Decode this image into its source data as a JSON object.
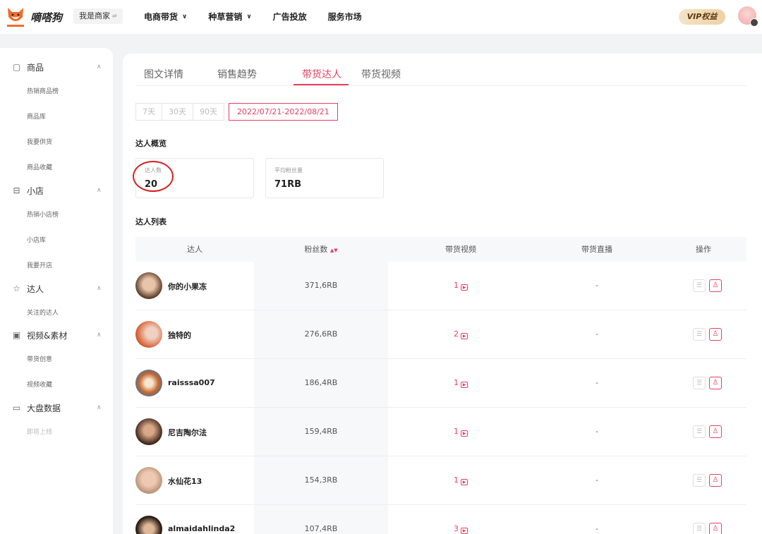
{
  "header": {
    "brand": "嘀嗒狗",
    "role_switch": "我是商家",
    "nav": [
      {
        "label": "电商带货",
        "has_dropdown": true
      },
      {
        "label": "种草营销",
        "has_dropdown": true
      },
      {
        "label": "广告投放",
        "has_dropdown": false
      },
      {
        "label": "服务市场",
        "has_dropdown": false
      }
    ],
    "vip_label": "VIP权益"
  },
  "sidebar": {
    "groups": [
      {
        "label": "商品",
        "icon": "bag-icon",
        "items": [
          "热销商品榜",
          "商品库",
          "我要供货",
          "商品收藏"
        ]
      },
      {
        "label": "小店",
        "icon": "store-icon",
        "items": [
          "热销小店榜",
          "小店库",
          "我要开店"
        ]
      },
      {
        "label": "达人",
        "icon": "star-icon",
        "items": [
          "关注的达人"
        ]
      },
      {
        "label": "视频&素材",
        "icon": "video-icon",
        "items": [
          "带货创意",
          "视频收藏"
        ]
      },
      {
        "label": "大盘数据",
        "icon": "monitor-icon",
        "items": [
          "即将上线"
        ]
      }
    ]
  },
  "tabs": [
    "图文详情",
    "销售趋势",
    "带货达人",
    "带货视频"
  ],
  "active_tab": "带货达人",
  "date_filters": [
    "7天",
    "30天",
    "90天"
  ],
  "date_range": "2022/07/21-2022/08/21",
  "overview": {
    "title": "达人概览",
    "stats": [
      {
        "label": "达人数",
        "value": "20"
      },
      {
        "label": "平均粉丝量",
        "value": "71RB"
      }
    ]
  },
  "list": {
    "title": "达人列表",
    "columns": [
      "达人",
      "粉丝数",
      "带货视频",
      "带货直播",
      "操作"
    ],
    "rows": [
      {
        "name": "你的小果冻",
        "fans": "371,6RB",
        "videos": "1",
        "live": "-"
      },
      {
        "name": "独特的",
        "fans": "276,6RB",
        "videos": "2",
        "live": "-"
      },
      {
        "name": "raisssa007",
        "fans": "186,4RB",
        "videos": "1",
        "live": "-"
      },
      {
        "name": "尼吉陶尔法",
        "fans": "159,4RB",
        "videos": "1",
        "live": "-"
      },
      {
        "name": "水仙花13",
        "fans": "154,3RB",
        "videos": "1",
        "live": "-"
      },
      {
        "name": "almaidahlinda2",
        "fans": "107,4RB",
        "videos": "3",
        "live": "-"
      }
    ]
  },
  "colors": {
    "accent": "#e83e5e",
    "annotation": "#d62020"
  }
}
